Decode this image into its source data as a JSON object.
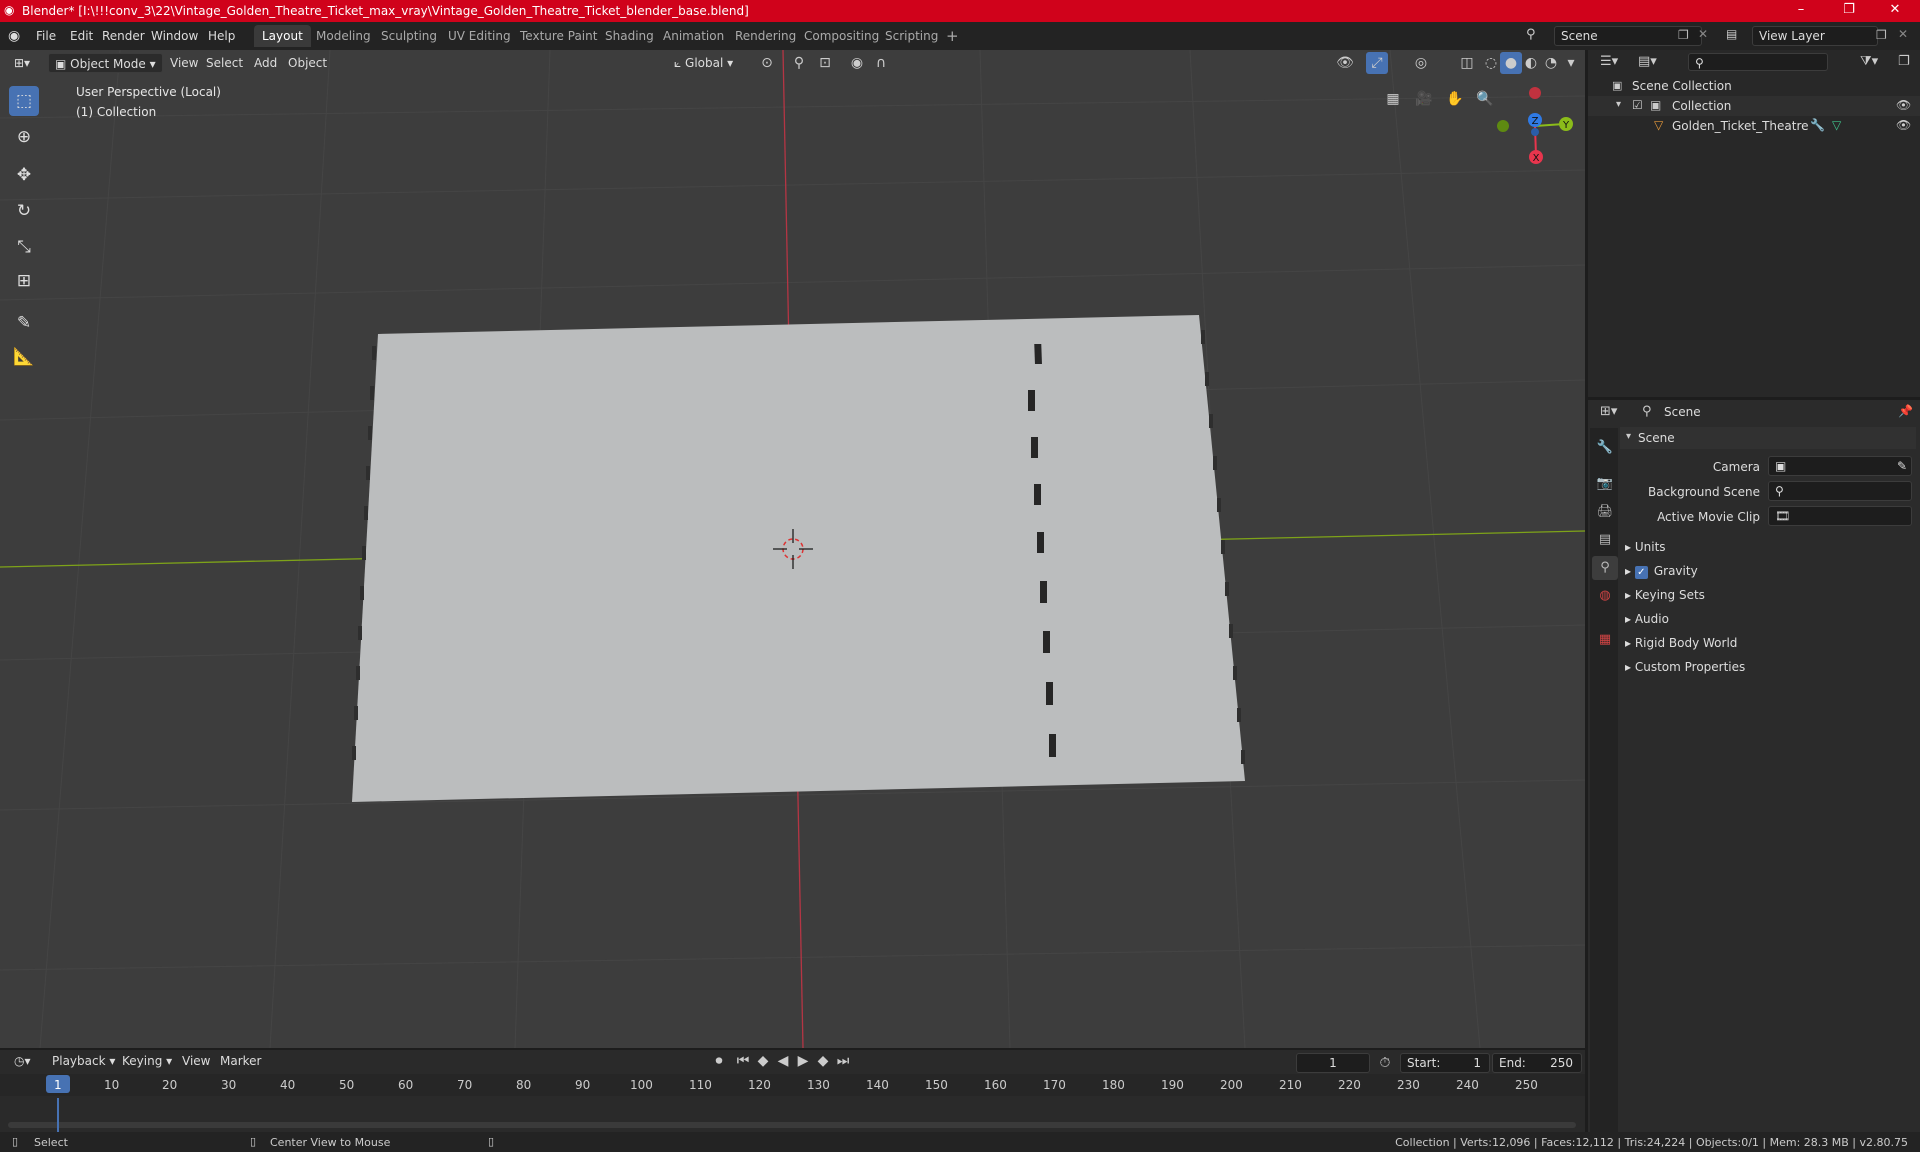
{
  "window": {
    "title": "Blender* [I:\\!!!conv_3\\22\\Vintage_Golden_Theatre_Ticket_max_vray\\Vintage_Golden_Theatre_Ticket_blender_base.blend]",
    "minimize": "–",
    "maximize": "❐",
    "close": "✕"
  },
  "menu": {
    "file": "File",
    "edit": "Edit",
    "render": "Render",
    "window": "Window",
    "help": "Help"
  },
  "workspaces": [
    "Layout",
    "Modeling",
    "Sculpting",
    "UV Editing",
    "Texture Paint",
    "Shading",
    "Animation",
    "Rendering",
    "Compositing",
    "Scripting"
  ],
  "topright": {
    "scene": "Scene",
    "view_layer": "View Layer"
  },
  "viewport_header": {
    "mode": "Object Mode",
    "view": "View",
    "select": "Select",
    "add": "Add",
    "object": "Object",
    "transform_orientation": "Global"
  },
  "viewport": {
    "perspective": "User Perspective (Local)",
    "collection": "(1) Collection",
    "gizmo": {
      "z": "Z",
      "y": "Y",
      "x": "X"
    }
  },
  "outliner": {
    "root": "Scene Collection",
    "collection": "Collection",
    "object": "Golden_Ticket_Theatre"
  },
  "properties": {
    "header": "Scene",
    "panel": "Scene",
    "camera_label": "Camera",
    "background_label": "Background Scene",
    "clip_label": "Active Movie Clip",
    "sections": [
      "Units",
      "Gravity",
      "Keying Sets",
      "Audio",
      "Rigid Body World",
      "Custom Properties"
    ]
  },
  "timeline": {
    "playback": "Playback",
    "keying": "Keying",
    "view": "View",
    "marker": "Marker",
    "current_frame": "1",
    "start_label": "Start:",
    "start": "1",
    "end_label": "End:",
    "end": "250",
    "ticks": [
      "1",
      "10",
      "20",
      "30",
      "40",
      "50",
      "60",
      "70",
      "80",
      "90",
      "100",
      "110",
      "120",
      "130",
      "140",
      "150",
      "160",
      "170",
      "180",
      "190",
      "200",
      "210",
      "220",
      "230",
      "240",
      "250"
    ]
  },
  "status": {
    "select": "Select",
    "center": "Center View to Mouse",
    "stats": "Collection | Verts:12,096 | Faces:12,112 | Tris:24,224 | Objects:0/1 | Mem: 28.3 MB | v2.80.75"
  },
  "colors": {
    "title_bar": "#d0021b",
    "active_tool": "#4772b3",
    "axis_x": "#e8354d",
    "axis_y": "#8bbc1a",
    "axis_z": "#2f7ae5"
  }
}
